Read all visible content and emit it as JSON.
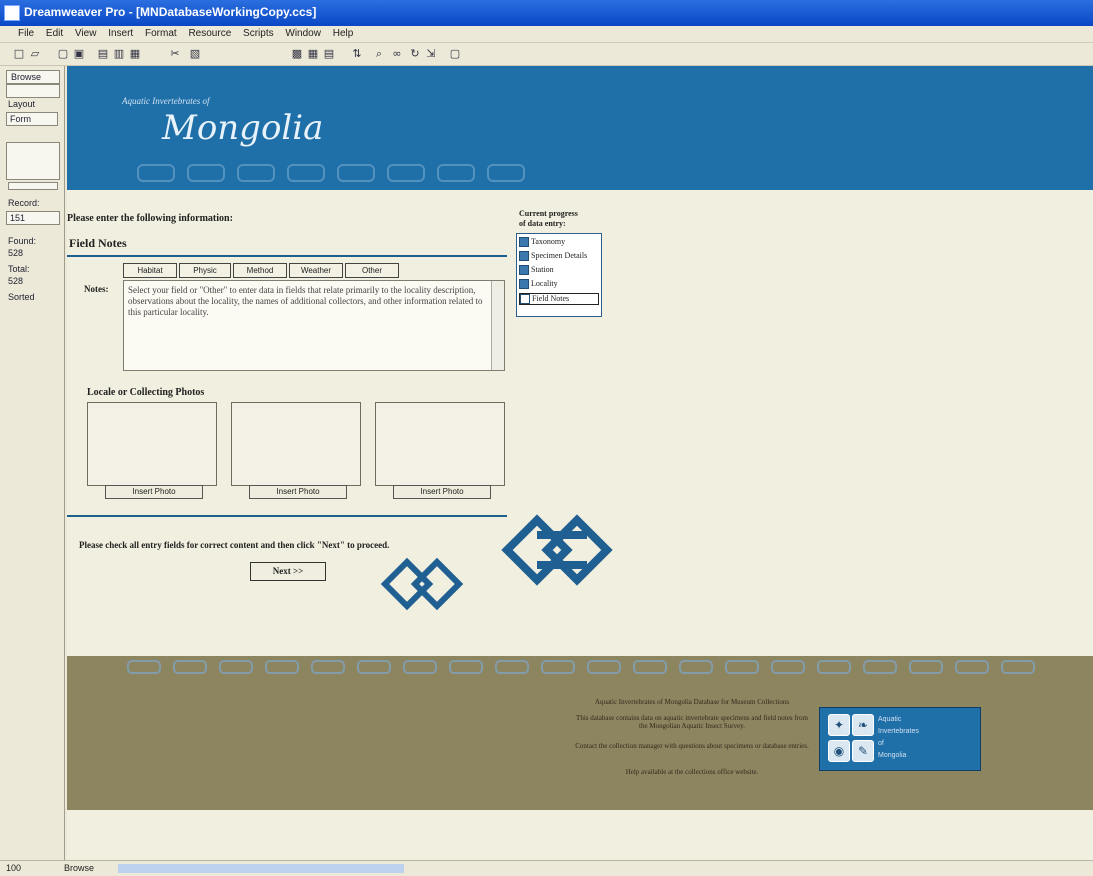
{
  "window": {
    "title": "Dreamweaver Pro - [MNDatabaseWorkingCopy.ccs]"
  },
  "menu": [
    "File",
    "Edit",
    "View",
    "Insert",
    "Format",
    "Resource",
    "Scripts",
    "Window",
    "Help"
  ],
  "left_panel": {
    "top_label": "Browse",
    "layout_label": "Layout",
    "layout_value": "Form",
    "record_label": "Record:",
    "record_value": "151",
    "found_label": "Found:",
    "found_value": "528",
    "total_label": "Total:",
    "total_value": "528",
    "sort_label": "Sorted"
  },
  "banner": {
    "subtitle": "Aquatic Invertebrates of",
    "title": "Mongolia"
  },
  "form": {
    "prompt": "Please enter the following information:",
    "section_title": "Field Notes",
    "tabs": [
      "Habitat",
      "Physic",
      "Method",
      "Weather",
      "Other"
    ],
    "notes_label": "Notes:",
    "notes_text": "Select your field or \"Other\" to enter data in fields that relate primarily to the locality description, observations about the locality, the names of additional collectors, and other information related to this particular locality.",
    "photos_title": "Locale or Collecting Photos",
    "insert_labels": [
      "Insert Photo",
      "Insert Photo",
      "Insert Photo"
    ],
    "check_note": "Please check all entry fields for correct content and then click \"Next\" to proceed.",
    "next_label": "Next >>"
  },
  "progress": {
    "title": "Current progress",
    "subtitle": "of data entry:",
    "items": [
      {
        "label": "Taxonomy",
        "done": true
      },
      {
        "label": "Specimen Details",
        "done": true
      },
      {
        "label": "Station",
        "done": true
      },
      {
        "label": "Locality",
        "done": true
      },
      {
        "label": "Field Notes",
        "done": false
      }
    ]
  },
  "footer": {
    "lines": [
      "Aquatic Invertebrates of Mongolia Database for Museum Collections",
      "This database contains data on aquatic invertebrate specimens and field notes from the Mongolian Aquatic Insect Survey.",
      "Contact the collection manager with questions about specimens or database entries.",
      "Help available at the collections office website."
    ],
    "logo_lines": [
      "Aquatic",
      "Invertebrates",
      "of",
      "Mongolia"
    ]
  },
  "status": {
    "zoom": "100",
    "mode": "Browse"
  },
  "colors": {
    "banner": "#1f6fa8",
    "footer": "#8d8460",
    "canvas": "#f1efdf"
  }
}
